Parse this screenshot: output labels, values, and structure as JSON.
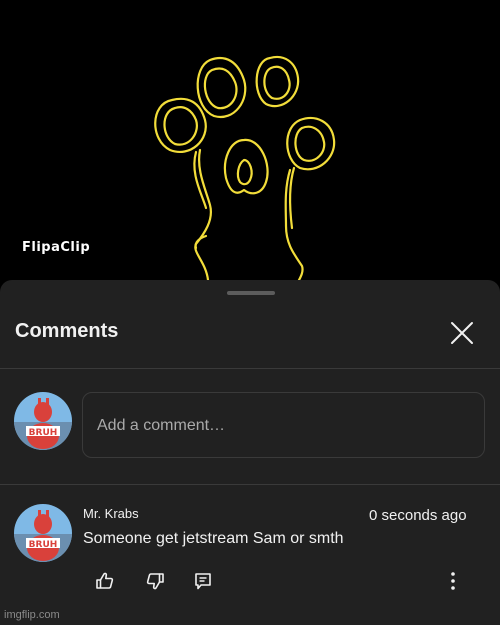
{
  "video": {
    "watermark": "FlipaClip"
  },
  "comments_panel": {
    "title": "Comments",
    "input": {
      "placeholder": "Add a comment…",
      "value": ""
    },
    "comments": [
      {
        "author": "Mr. Krabs",
        "timestamp": "0 seconds ago",
        "text": "Someone get jetstream Sam or smth",
        "avatar_text": "BRUH"
      }
    ],
    "current_user": {
      "avatar_text": "BRUH"
    }
  },
  "icons": {
    "close": "close-icon",
    "like": "thumbs-up-icon",
    "dislike": "thumbs-down-icon",
    "reply": "reply-icon",
    "more": "more-vertical-icon"
  },
  "colors": {
    "paw_stroke": "#f2dd3a",
    "sheet_bg": "#212121",
    "text": "#f1f1f1",
    "muted": "#aaaaaa"
  },
  "site_watermark": "imgflip.com"
}
